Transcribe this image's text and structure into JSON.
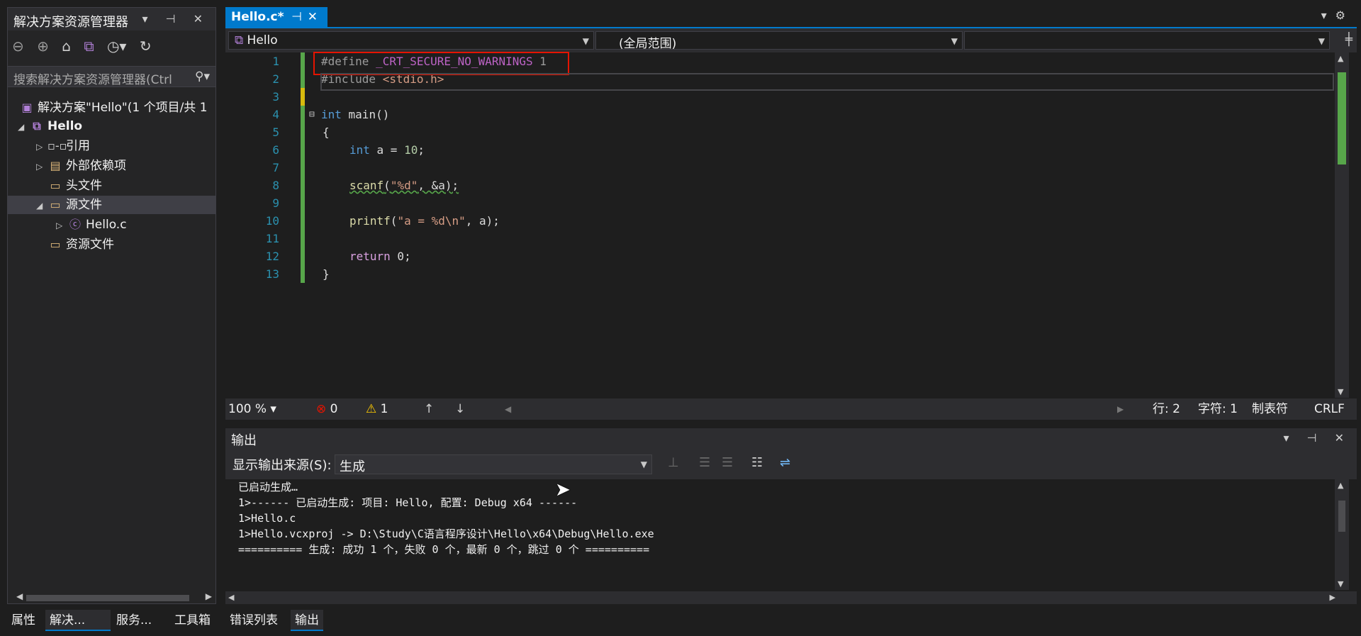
{
  "solution_explorer": {
    "title": "解决方案资源管理器",
    "title_buttons": "▾ ⊣ ✕",
    "toolbar_icons": [
      "back-icon",
      "forward-icon",
      "home-icon",
      "vs-icon",
      "history-icon",
      "refresh-icon"
    ],
    "search_placeholder": "搜索解决方案资源管理器(Ctrl",
    "tree": [
      {
        "label": "解决方案\"Hello\"(1 个项目/共 1",
        "icon": "solution-icon"
      },
      {
        "label": "Hello",
        "icon": "project-icon"
      },
      {
        "label": "引用",
        "icon": "references-icon"
      },
      {
        "label": "外部依赖项",
        "icon": "external-deps-icon"
      },
      {
        "label": "头文件",
        "icon": "filter-folder-icon"
      },
      {
        "label": "源文件",
        "icon": "filter-folder-icon"
      },
      {
        "label": "Hello.c",
        "icon": "c-file-icon"
      },
      {
        "label": "资源文件",
        "icon": "filter-folder-icon"
      }
    ],
    "bottom_tabs": [
      "属性",
      "解决...",
      "服务...",
      "工具箱"
    ]
  },
  "editor": {
    "tab_label": "Hello.c*",
    "nav": {
      "project": "Hello",
      "scope": "(全局范围)",
      "member": ""
    },
    "lines": [
      {
        "n": "1",
        "text": ""
      },
      {
        "n": "2",
        "text": ""
      },
      {
        "n": "3",
        "text": ""
      },
      {
        "n": "4",
        "text": ""
      },
      {
        "n": "5",
        "text": ""
      },
      {
        "n": "6",
        "text": ""
      },
      {
        "n": "7",
        "text": ""
      },
      {
        "n": "8",
        "text": ""
      },
      {
        "n": "9",
        "text": ""
      },
      {
        "n": "10",
        "text": ""
      },
      {
        "n": "11",
        "text": ""
      },
      {
        "n": "12",
        "text": ""
      },
      {
        "n": "13",
        "text": ""
      }
    ],
    "code": {
      "l1a": "#define",
      "l1b": " _CRT_SECURE_NO_WARNINGS ",
      "l1c": "1",
      "l2a": "#include",
      "l2b": " <stdio.h>",
      "l4a": "int",
      "l4b": " main()",
      "l5": "{",
      "l6a": "int",
      "l6b": " a = ",
      "l6c": "10",
      "l6d": ";",
      "l8a": "scanf",
      "l8b": "(",
      "l8c": "\"%d\"",
      "l8d": ", &a);",
      "l10a": "printf",
      "l10b": "(",
      "l10c": "\"a = %d\\n\"",
      "l10d": ", a);",
      "l12a": "return",
      "l12b": " 0;",
      "l13": "}"
    },
    "status": {
      "zoom": "100 %",
      "errors": "0",
      "warnings": "1",
      "line": "行: 2",
      "char": "字符: 1",
      "tabs": "制表符",
      "eol": "CRLF"
    }
  },
  "output": {
    "title": "输出",
    "source_label": "显示输出来源(S):",
    "source_value": "生成",
    "lines": [
      "已启动生成…",
      "1>------ 已启动生成: 项目: Hello, 配置: Debug x64 ------",
      "1>Hello.c",
      "1>Hello.vcxproj -> D:\\Study\\C语言程序设计\\Hello\\x64\\Debug\\Hello.exe",
      "========== 生成: 成功 1 个，失败 0 个，最新 0 个，跳过 0 个 =========="
    ],
    "bottom_tabs": [
      "错误列表",
      "输出"
    ]
  }
}
